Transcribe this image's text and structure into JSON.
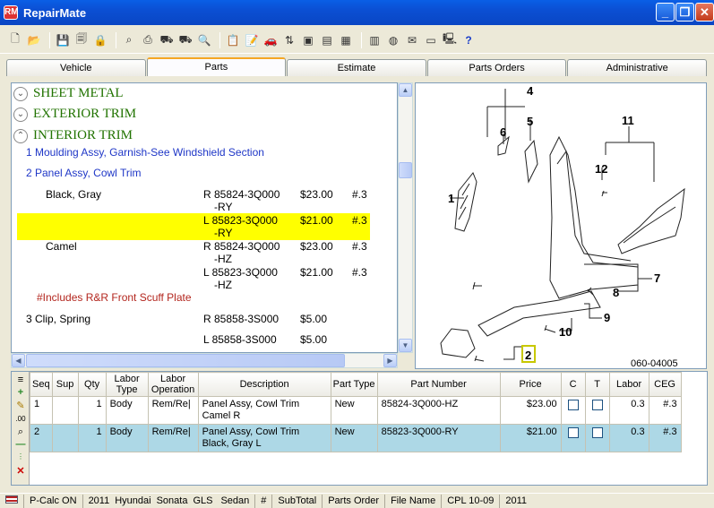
{
  "app": {
    "title": "RepairMate",
    "icon": "RM"
  },
  "tabs": [
    "Vehicle",
    "Parts",
    "Estimate",
    "Parts Orders",
    "Administrative"
  ],
  "active_tab": 1,
  "tree": {
    "categories": [
      "SHEET METAL",
      "EXTERIOR TRIM",
      "INTERIOR TRIM"
    ],
    "items": [
      "1 Moulding Assy, Garnish-See Windshield Section",
      "2 Panel Assy, Cowl Trim"
    ],
    "rows": [
      {
        "desc": "Black, Gray",
        "part": "R 85824-3Q000",
        "suffix": "-RY",
        "price": "$23.00",
        "ceg": "#.3"
      },
      {
        "desc": "",
        "part": "L 85823-3Q000",
        "suffix": "-RY",
        "price": "$21.00",
        "ceg": "#.3"
      },
      {
        "desc": "Camel",
        "part": "R 85824-3Q000",
        "suffix": "-HZ",
        "price": "$23.00",
        "ceg": "#.3"
      },
      {
        "desc": "",
        "part": "L 85823-3Q000",
        "suffix": "-HZ",
        "price": "$21.00",
        "ceg": "#.3"
      }
    ],
    "note": "#Includes R&R Front Scuff Plate",
    "item3": {
      "desc": "3 Clip, Spring",
      "rows": [
        {
          "part": "R 85858-3S000",
          "price": "$5.00"
        },
        {
          "part": "L 85858-3S000",
          "price": "$5.00"
        }
      ]
    }
  },
  "diagram": {
    "callouts": [
      "1",
      "2",
      "4",
      "5",
      "6",
      "7",
      "8",
      "9",
      "10",
      "11",
      "12"
    ],
    "code": "060-04005",
    "highlighted": "2"
  },
  "grid": {
    "columns": [
      "Seq",
      "Sup",
      "Qty",
      "Labor Type",
      "Labor Operation",
      "Description",
      "Part Type",
      "Part Number",
      "Price",
      "C",
      "T",
      "Labor",
      "CEG"
    ],
    "rows": [
      {
        "seq": "1",
        "sup": "",
        "qty": "1",
        "labor_type": "Body",
        "labor_op": "Rem/Re|",
        "desc1": "Panel Assy, Cowl Trim",
        "desc2": "Camel R",
        "part_type": "New",
        "part_number": "85824-3Q000-HZ",
        "price": "$23.00",
        "labor": "0.3",
        "ceg": "#.3"
      },
      {
        "seq": "2",
        "sup": "",
        "qty": "1",
        "labor_type": "Body",
        "labor_op": "Rem/Re|",
        "desc1": "Panel Assy, Cowl Trim",
        "desc2": "Black, Gray L",
        "part_type": "New",
        "part_number": "85823-3Q000-RY",
        "price": "$21.00",
        "labor": "0.3",
        "ceg": "#.3"
      }
    ]
  },
  "status": [
    "P-Calc ON",
    "2011",
    "Hyundai",
    "Sonata",
    "GLS",
    "Sedan",
    "#",
    "SubTotal",
    "Parts Order",
    "File Name",
    "CPL 10-09",
    "2011"
  ]
}
